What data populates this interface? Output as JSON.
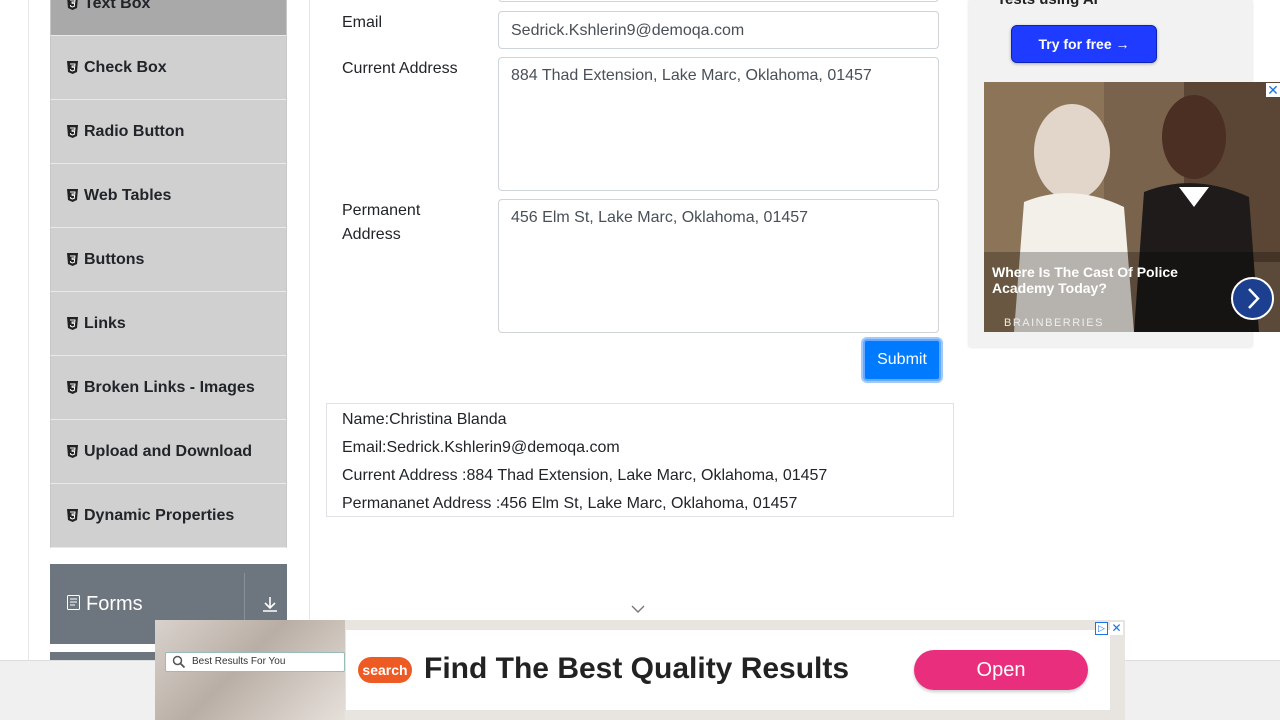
{
  "sidebar": {
    "items": [
      {
        "label": "Text Box",
        "icon": "html5-icon"
      },
      {
        "label": "Check Box",
        "icon": "html5-icon"
      },
      {
        "label": "Radio Button",
        "icon": "html5-icon"
      },
      {
        "label": "Web Tables",
        "icon": "html5-icon"
      },
      {
        "label": "Buttons",
        "icon": "html5-icon"
      },
      {
        "label": "Links",
        "icon": "html5-icon"
      },
      {
        "label": "Broken Links - Images",
        "icon": "html5-icon"
      },
      {
        "label": "Upload and Download",
        "icon": "html5-icon"
      },
      {
        "label": "Dynamic Properties",
        "icon": "html5-icon"
      }
    ],
    "group": {
      "label": "Forms",
      "icon": "document-icon"
    }
  },
  "form": {
    "email_label": "Email",
    "email_value": "Sedrick.Kshlerin9@demoqa.com",
    "current_label": "Current Address",
    "current_value": "884 Thad Extension, Lake Marc, Oklahoma, 01457",
    "permanent_label_1": "Permanent",
    "permanent_label_2": "Address",
    "permanent_value": "456 Elm St, Lake Marc, Oklahoma, 01457",
    "submit_label": "Submit"
  },
  "output": {
    "name": "Name:Christina Blanda",
    "email": "Email:Sedrick.Kshlerin9@demoqa.com",
    "current": "Current Address :884 Thad Extension, Lake Marc, Oklahoma, 01457",
    "permanent": "Permananet Address :456 Elm St, Lake Marc, Oklahoma, 01457"
  },
  "ad_right": {
    "cut_text": "Tests using AI",
    "button": "Try for free →",
    "caption": "Where Is The Cast Of Police Academy Today?",
    "brand": "BRAINBERRIES"
  },
  "ad_bottom": {
    "search_text": "Best Results For You",
    "logo": "search",
    "headline": "Find The Best Quality Results",
    "button": "Open"
  },
  "colors": {
    "accent": "#007bff",
    "sidebar_active": "#a9a9a9",
    "sidebar_item": "#d0d0d0",
    "group_header": "#6d757e",
    "ad_button": "#ea2e7e"
  }
}
